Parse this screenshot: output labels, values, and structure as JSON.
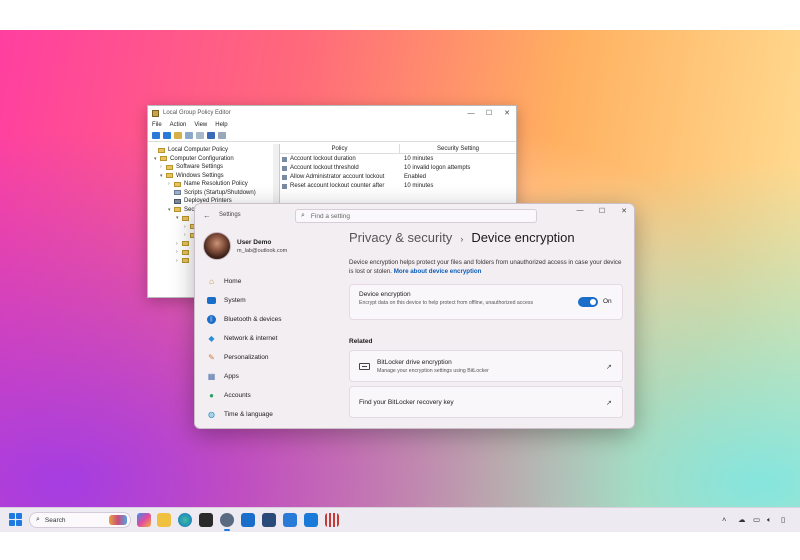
{
  "gpe": {
    "title": "Local Group Policy Editor",
    "menu": [
      "File",
      "Action",
      "View",
      "Help"
    ],
    "tree": [
      {
        "label": "Local Computer Policy",
        "level": 0
      },
      {
        "label": "Computer Configuration",
        "level": 1
      },
      {
        "label": "Software Settings",
        "level": 2
      },
      {
        "label": "Windows Settings",
        "level": 2
      },
      {
        "label": "Name Resolution Policy",
        "level": 3
      },
      {
        "label": "Scripts (Startup/Shutdown)",
        "level": 3
      },
      {
        "label": "Deployed Printers",
        "level": 3
      },
      {
        "label": "Sec",
        "level": 3
      }
    ],
    "columns": {
      "policy": "Policy",
      "setting": "Security Setting"
    },
    "rows": [
      {
        "policy": "Account lockout duration",
        "setting": "10 minutes"
      },
      {
        "policy": "Account lockout threshold",
        "setting": "10 invalid logon attempts"
      },
      {
        "policy": "Allow Administrator account lockout",
        "setting": "Enabled"
      },
      {
        "policy": "Reset account lockout counter after",
        "setting": "10 minutes"
      }
    ]
  },
  "settings": {
    "app_title": "Settings",
    "search_placeholder": "Find a setting",
    "user": {
      "name": "User Demo",
      "email": "m_lab@outlook.com"
    },
    "nav": [
      {
        "label": "Home",
        "icon": "home-icon",
        "color": "#c98a3a"
      },
      {
        "label": "System",
        "icon": "monitor-icon",
        "color": "#1a6ec9"
      },
      {
        "label": "Bluetooth & devices",
        "icon": "bluetooth-icon",
        "color": "#1a6ec9"
      },
      {
        "label": "Network & internet",
        "icon": "wifi-icon",
        "color": "#2a8fd8"
      },
      {
        "label": "Personalization",
        "icon": "brush-icon",
        "color": "#d07a3a"
      },
      {
        "label": "Apps",
        "icon": "apps-icon",
        "color": "#4a6fa8"
      },
      {
        "label": "Accounts",
        "icon": "person-icon",
        "color": "#2aa06a"
      },
      {
        "label": "Time & language",
        "icon": "globe-icon",
        "color": "#1a8fc0"
      }
    ],
    "breadcrumb": {
      "parent": "Privacy & security",
      "separator": "›",
      "current": "Device encryption"
    },
    "description": "Device encryption helps protect your files and folders from unauthorized access in case your device is lost or stolen.",
    "description_link": "More about device encryption",
    "encryption": {
      "title": "Device encryption",
      "subtitle": "Encrypt data on this device to help protect from offline, unauthorized access",
      "toggle_label": "On"
    },
    "related_label": "Related",
    "bitlocker": {
      "title": "BitLocker drive encryption",
      "subtitle": "Manage your encryption settings using BitLocker"
    },
    "recovery_key": {
      "title": "Find your BitLocker recovery key"
    }
  },
  "taskbar": {
    "search_label": "Search"
  },
  "colors": {
    "accent": "#1a6ec9",
    "link": "#0b5cb5"
  }
}
